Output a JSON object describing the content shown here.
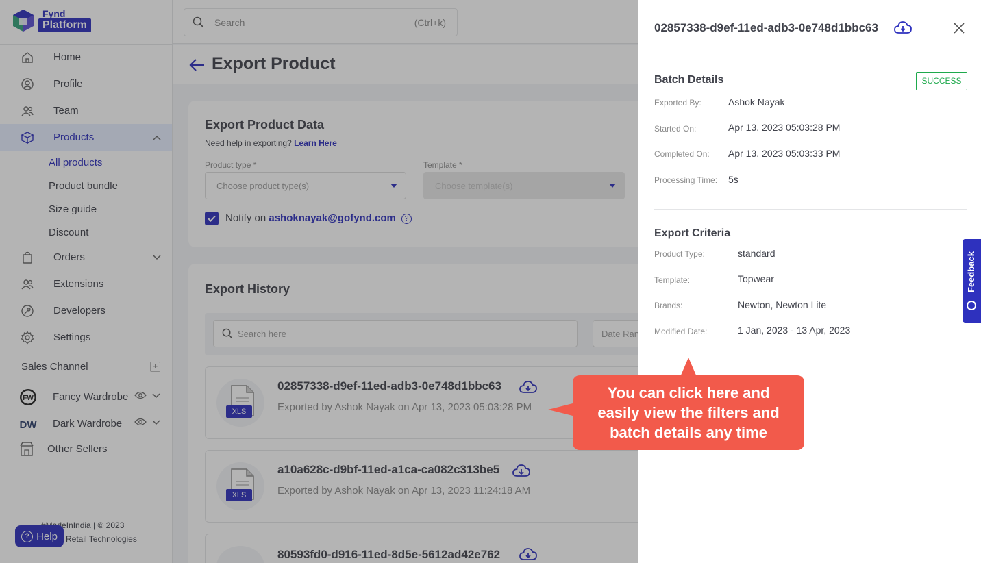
{
  "brand": {
    "logo_top": "Fynd",
    "logo_bottom": "Platform"
  },
  "search": {
    "placeholder": "Search",
    "shortcut": "(Ctrl+k)"
  },
  "sidebar": {
    "items": [
      {
        "label": "Home"
      },
      {
        "label": "Profile"
      },
      {
        "label": "Team"
      },
      {
        "label": "Products"
      },
      {
        "label": "Orders"
      },
      {
        "label": "Extensions"
      },
      {
        "label": "Developers"
      },
      {
        "label": "Settings"
      }
    ],
    "product_sub": [
      "All products",
      "Product bundle",
      "Size guide",
      "Discount"
    ],
    "sales_channel_title": "Sales Channel",
    "channels": [
      {
        "label": "Fancy Wardrobe",
        "logo": "FW"
      },
      {
        "label": "Dark Wardrobe",
        "logo": "DW"
      }
    ],
    "other_sellers": "Other Sellers",
    "footer_line1": "#MadeInIndia | © 2023",
    "footer_line2": "e Retail Technologies",
    "help_label": "Help"
  },
  "page": {
    "title": "Export Product",
    "export_card": {
      "title": "Export Product Data",
      "help_text": "Need help in exporting?",
      "help_link": "Learn Here",
      "product_type_label": "Product type *",
      "product_type_placeholder": "Choose product type(s)",
      "template_label": "Template *",
      "template_placeholder": "Choose template(s)",
      "notify_prefix": "Notify on",
      "notify_email": "ashoknayak@gofynd.com"
    },
    "history": {
      "title": "Export History",
      "search_placeholder": "Search here",
      "date_placeholder": "Date Range",
      "rows": [
        {
          "id": "02857338-d9ef-11ed-adb3-0e748d1bbc63",
          "subtitle": "Exported by Ashok Nayak on Apr 13, 2023 05:03:28 PM",
          "file_type": "XLS"
        },
        {
          "id": "a10a628c-d9bf-11ed-a1ca-ca082c313be5",
          "subtitle": "Exported by Ashok Nayak on Apr 13, 2023 11:24:18 AM",
          "file_type": "XLS"
        },
        {
          "id": "80593fd0-d916-11ed-8d5e-5612ad42e762",
          "subtitle": "",
          "file_type": ""
        }
      ]
    }
  },
  "drawer": {
    "title": "02857338-d9ef-11ed-adb3-0e748d1bbc63",
    "batch": {
      "title": "Batch Details",
      "status": "SUCCESS",
      "exported_by_label": "Exported By:",
      "exported_by": "Ashok Nayak",
      "started_label": "Started On:",
      "started": "Apr 13, 2023 05:03:28 PM",
      "completed_label": "Completed On:",
      "completed": "Apr 13, 2023 05:03:33 PM",
      "processing_label": "Processing Time:",
      "processing": "5s"
    },
    "criteria": {
      "title": "Export Criteria",
      "product_type_label": "Product Type:",
      "product_type": "standard",
      "template_label": "Template:",
      "template": "Topwear",
      "brands_label": "Brands:",
      "brands": "Newton, Newton Lite",
      "modified_label": "Modified Date:",
      "modified": "1 Jan, 2023 - 13 Apr, 2023"
    }
  },
  "feedback": "Feedback",
  "callout": {
    "line1": "You can click here and",
    "line2": "easily view the filters and",
    "line3": "batch details any time"
  },
  "colors": {
    "accent": "#2e31be",
    "success": "#1ea94c",
    "callout": "#f25a4b"
  }
}
